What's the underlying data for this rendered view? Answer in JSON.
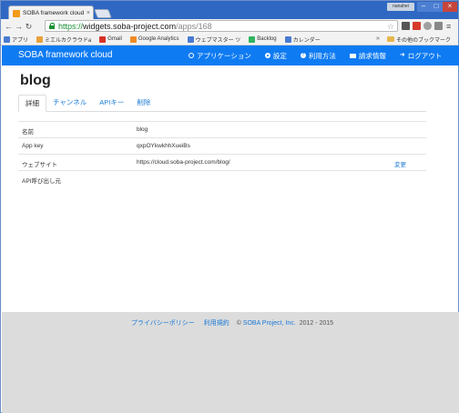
{
  "browser": {
    "tab_title": "SOBA framework cloud",
    "user_badge": "nanahei",
    "url_scheme": "https://",
    "url_host": "widgets.soba-project.com",
    "url_path": "/apps/168",
    "bookmarks": [
      {
        "label": "アプリ",
        "icon_color": "#4a7bd1"
      },
      {
        "label": "ミエルカクラウドa",
        "icon_color": "#e9a13b"
      },
      {
        "label": "Gmail",
        "icon_color": "#d93025"
      },
      {
        "label": "Google Analytics",
        "icon_color": "#f08a24"
      },
      {
        "label": "ウェブマスター ツ",
        "icon_color": "#4a7bd1"
      },
      {
        "label": "Backlog",
        "icon_color": "#2fb560"
      },
      {
        "label": "カレンダー",
        "icon_color": "#4a7bd1"
      }
    ],
    "bookmarks_more": "»",
    "other_bookmarks": "その他のブックマーク"
  },
  "navbar": {
    "brand": "SOBA framework cloud",
    "items": [
      {
        "label": "アプリケーション",
        "icon": "globe-icon"
      },
      {
        "label": "設定",
        "icon": "gear-icon"
      },
      {
        "label": "利用方法",
        "icon": "help-icon"
      },
      {
        "label": "請求情報",
        "icon": "card-icon"
      },
      {
        "label": "ログアウト",
        "icon": "logout-icon"
      }
    ],
    "color": "#0f7bf2"
  },
  "page": {
    "title": "blog",
    "tabs": [
      "詳細",
      "チャンネル",
      "APIキー",
      "削除"
    ],
    "active_tab": "詳細"
  },
  "details": {
    "name_label": "名前",
    "name_value": "blog",
    "appkey_label": "App key",
    "appkey_value": "qxpOYkwkhhXueiBs",
    "website_label": "ウェブサイト",
    "website_value": "https://cloud.soba-project.com/blog/",
    "website_action": "変更",
    "api_label": "API呼び出し元"
  },
  "footer": {
    "privacy": "プライバシーポリシー",
    "terms": "利用規約",
    "copyright_prefix": "© ",
    "company": "SOBA Project, Inc.",
    "years": " 2012 - 2015"
  }
}
